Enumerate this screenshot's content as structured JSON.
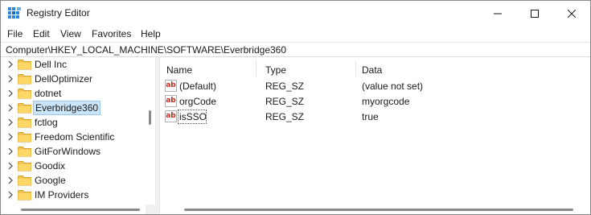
{
  "window": {
    "title": "Registry Editor",
    "accent": "#0067c0"
  },
  "menu": [
    "File",
    "Edit",
    "View",
    "Favorites",
    "Help"
  ],
  "address": "Computer\\HKEY_LOCAL_MACHINE\\SOFTWARE\\Everbridge360",
  "tree": {
    "items": [
      {
        "label": "Dell Inc",
        "icon": "folder-icon",
        "selected": false
      },
      {
        "label": "DellOptimizer",
        "icon": "folder-icon",
        "selected": false
      },
      {
        "label": "dotnet",
        "icon": "folder-icon",
        "selected": false
      },
      {
        "label": "Everbridge360",
        "icon": "folder-icon",
        "selected": true
      },
      {
        "label": "fctlog",
        "icon": "folder-icon",
        "selected": false
      },
      {
        "label": "Freedom Scientific",
        "icon": "folder-icon",
        "selected": false
      },
      {
        "label": "GitForWindows",
        "icon": "folder-icon",
        "selected": false
      },
      {
        "label": "Goodix",
        "icon": "folder-icon",
        "selected": false
      },
      {
        "label": "Google",
        "icon": "folder-icon",
        "selected": false
      },
      {
        "label": "IM Providers",
        "icon": "folder-icon",
        "selected": false
      }
    ]
  },
  "list": {
    "columns": [
      "Name",
      "Type",
      "Data"
    ],
    "rows": [
      {
        "name": "(Default)",
        "type": "REG_SZ",
        "data": "(value not set)",
        "icon": "string-value-icon"
      },
      {
        "name": "orgCode",
        "type": "REG_SZ",
        "data": "myorgcode",
        "icon": "string-value-icon"
      },
      {
        "name": "isSSO",
        "type": "REG_SZ",
        "data": "true",
        "icon": "string-value-icon"
      }
    ],
    "icon_text": "ab"
  }
}
